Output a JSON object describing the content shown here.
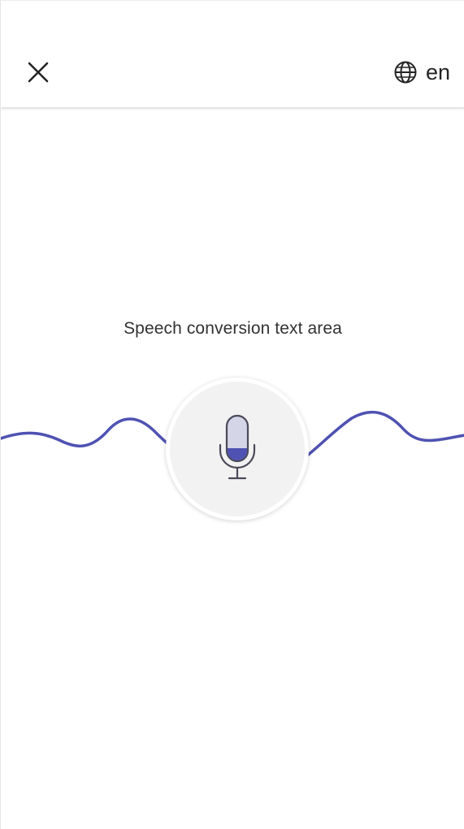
{
  "header": {
    "close_icon": "close-icon",
    "language_icon": "globe-icon",
    "language_code": "en"
  },
  "main": {
    "status_text": "Speech conversion text area",
    "mic_icon": "microphone-icon",
    "wave_icon": "audio-waveform"
  },
  "colors": {
    "accent": "#4f52b2",
    "mic_body": "#d4d5e6",
    "mic_outline": "#4a4a5a",
    "text": "#242424"
  }
}
